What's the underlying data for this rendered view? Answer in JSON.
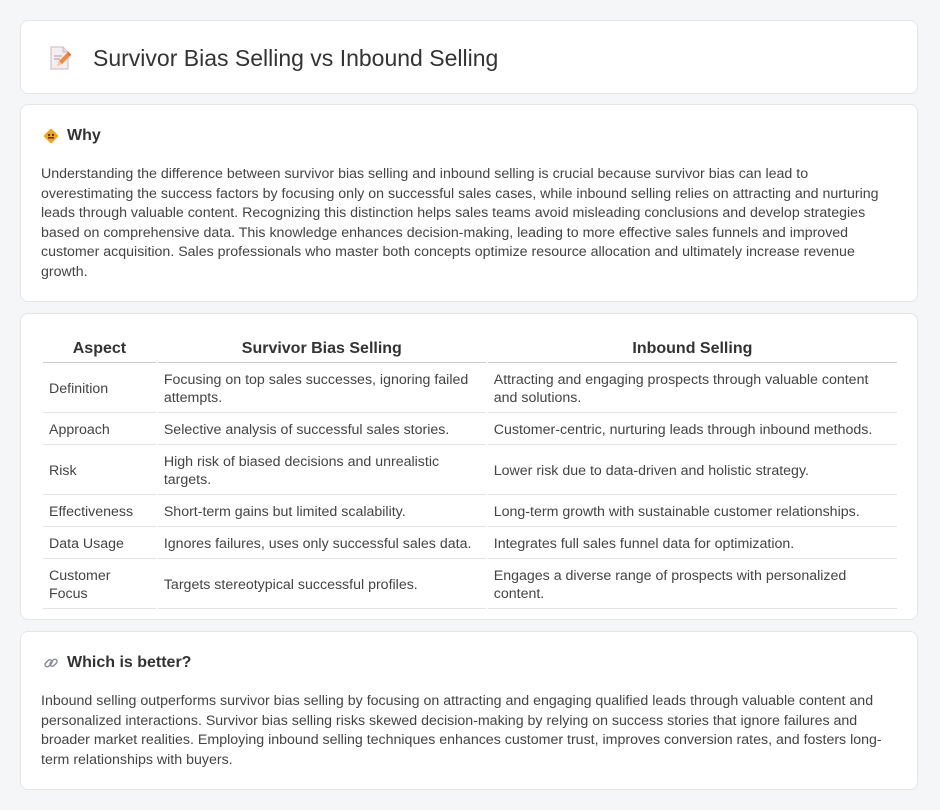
{
  "header": {
    "title": "Survivor Bias Selling vs Inbound Selling",
    "icon": "document-pencil-icon"
  },
  "why": {
    "title": "Why",
    "icon": "diamond-sign-icon",
    "text": "Understanding the difference between survivor bias selling and inbound selling is crucial because survivor bias can lead to overestimating the success factors by focusing only on successful sales cases, while inbound selling relies on attracting and nurturing leads through valuable content. Recognizing this distinction helps sales teams avoid misleading conclusions and develop strategies based on comprehensive data. This knowledge enhances decision-making, leading to more effective sales funnels and improved customer acquisition. Sales professionals who master both concepts optimize resource allocation and ultimately increase revenue growth."
  },
  "table": {
    "headers": [
      "Aspect",
      "Survivor Bias Selling",
      "Inbound Selling"
    ],
    "rows": [
      {
        "aspect": "Definition",
        "survivor": "Focusing on top sales successes, ignoring failed attempts.",
        "inbound": "Attracting and engaging prospects through valuable content and solutions."
      },
      {
        "aspect": "Approach",
        "survivor": "Selective analysis of successful sales stories.",
        "inbound": "Customer-centric, nurturing leads through inbound methods."
      },
      {
        "aspect": "Risk",
        "survivor": "High risk of biased decisions and unrealistic targets.",
        "inbound": "Lower risk due to data-driven and holistic strategy."
      },
      {
        "aspect": "Effectiveness",
        "survivor": "Short-term gains but limited scalability.",
        "inbound": "Long-term growth with sustainable customer relationships."
      },
      {
        "aspect": "Data Usage",
        "survivor": "Ignores failures, uses only successful sales data.",
        "inbound": "Integrates full sales funnel data for optimization."
      },
      {
        "aspect": "Customer Focus",
        "survivor": "Targets stereotypical successful profiles.",
        "inbound": "Engages a diverse range of prospects with personalized content."
      }
    ]
  },
  "better": {
    "title": "Which is better?",
    "icon": "link-icon",
    "text": "Inbound selling outperforms survivor bias selling by focusing on attracting and engaging qualified leads through valuable content and personalized interactions. Survivor bias selling risks skewed decision-making by relying on success stories that ignore failures and broader market realities. Employing inbound selling techniques enhances customer trust, improves conversion rates, and fosters long-term relationships with buyers."
  }
}
